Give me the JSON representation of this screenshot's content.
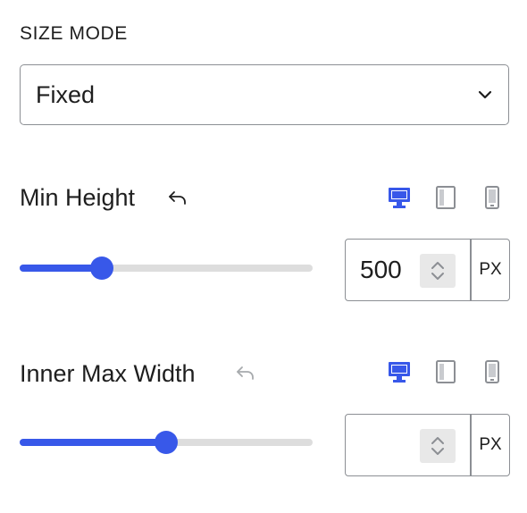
{
  "size_mode": {
    "label": "SIZE MODE",
    "selected": "Fixed"
  },
  "min_height": {
    "label": "Min Height",
    "reset_icon": "undo-arrow-icon",
    "devices": [
      "desktop-icon",
      "tablet-icon",
      "mobile-icon"
    ],
    "active_device": "desktop",
    "slider_fraction": 0.28,
    "value": "500",
    "unit": "PX"
  },
  "inner_max_width": {
    "label": "Inner Max Width",
    "reset_icon": "undo-arrow-icon",
    "devices": [
      "desktop-icon",
      "tablet-icon",
      "mobile-icon"
    ],
    "active_device": "desktop",
    "slider_fraction": 0.5,
    "value": "",
    "unit": "PX"
  },
  "colors": {
    "accent": "#3858e9",
    "reset_active": "#1e1e1e",
    "reset_inactive": "#a7aaad",
    "device_inactive": "#8c8f94"
  }
}
